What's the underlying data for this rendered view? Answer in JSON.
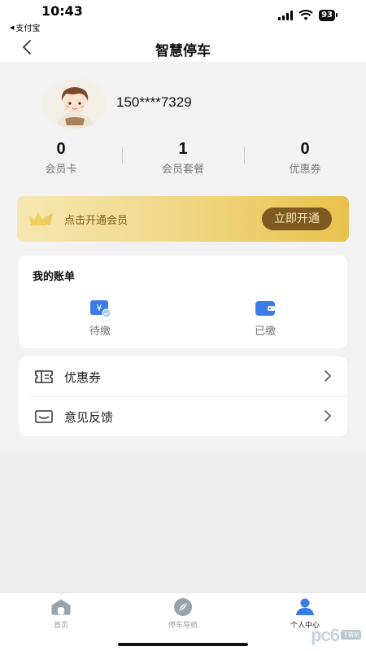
{
  "status_bar": {
    "time": "10:43",
    "back_app": "支付宝",
    "battery": "93"
  },
  "header": {
    "title": "智慧停车"
  },
  "profile": {
    "phone": "150****7329"
  },
  "stats": [
    {
      "value": "0",
      "label": "会员卡"
    },
    {
      "value": "1",
      "label": "会员套餐"
    },
    {
      "value": "0",
      "label": "优惠券"
    }
  ],
  "vip_banner": {
    "text": "点击开通会员",
    "button_label": "立即开通"
  },
  "bills": {
    "title": "我的账单",
    "items": [
      {
        "label": "待缴",
        "icon": "yuan-bill-icon"
      },
      {
        "label": "已缴",
        "icon": "wallet-icon"
      }
    ]
  },
  "menu": [
    {
      "label": "优惠券",
      "icon": "ticket-icon"
    },
    {
      "label": "意见反馈",
      "icon": "mail-icon"
    }
  ],
  "tab_bar": {
    "items": [
      {
        "label": "首页",
        "icon": "home-icon",
        "active": false
      },
      {
        "label": "停车导航",
        "icon": "compass-icon",
        "active": false
      },
      {
        "label": "个人中心",
        "icon": "user-icon",
        "active": true
      }
    ]
  },
  "watermark": {
    "logo": "pc6",
    "tag": "下载站"
  },
  "colors": {
    "accent_blue": "#3a7be8",
    "vip_brown": "#7e5a22",
    "vip_gold": "#e9c24c"
  }
}
